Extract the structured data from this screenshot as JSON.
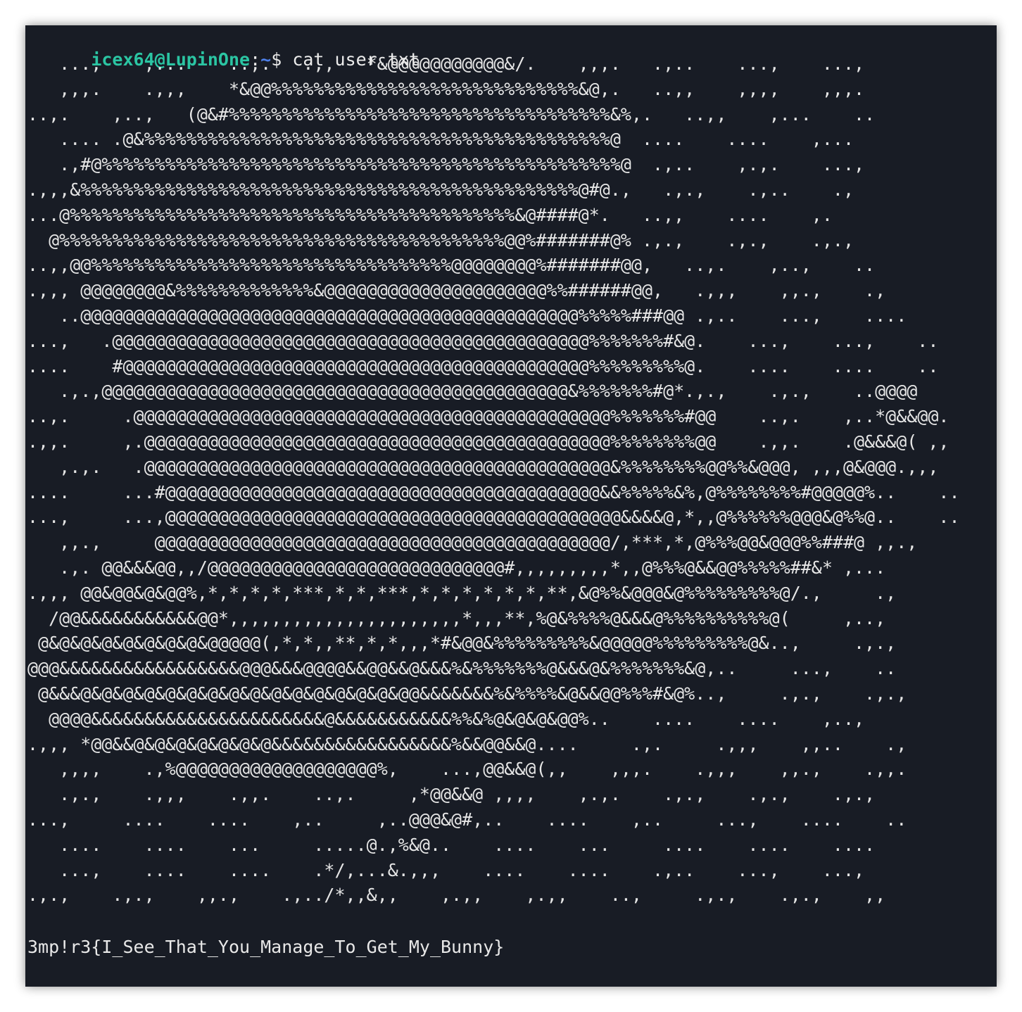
{
  "terminal": {
    "prompt_user_host": "icex64@LupinOne",
    "prompt_sep": ":",
    "prompt_path": "~",
    "prompt_symbol": "$ ",
    "command": "cat user.txt",
    "art_lines": [
      "   ...,    ,...    ..,.   .,,   *&@@@@@@@@@@@&/.    ,,,.   .,..    ...,    ...,",
      "   ,,,.    .,,,    *&@@%%%%%%%%%%%%%%%%%%%%%%%%%%%%%&@,.   ..,,    ,,,,    ,,,.",
      "..,.    ,..,   (@&#%%%%%%%%%%%%%%%%%%%%%%%%%%%%%%%%%%%%&%,.   ..,,    ,...    ..",
      "   .... .@&%%%%%%%%%%%%%%%%%%%%%%%%%%%%%%%%%%%%%%%%%%%%@  ....    ....    ,...",
      "   .,#@%%%%%%%%%%%%%%%%%%%%%%%%%%%%%%%%%%%%%%%%%%%%%%%%%@  .,..    ,.,.    ...,",
      ".,,,&%%%%%%%%%%%%%%%%%%%%%%%%%%%%%%%%%%%%%%%%%%%%%%%@#@.,   .,.,    .,..    .,",
      "...@%%%%%%%%%%%%%%%%%%%%%%%%%%%%%%%%%%%%%%%%%%&@####@*.   ..,,    ....    ,.",
      "  @%%%%%%%%%%%%%%%%%%%%%%%%%%%%%%%%%%%%%%%%%%@@%#######@% .,.,    .,.,    .,.,",
      "..,,@@%%%%%%%%%%%%%%%%%%%%%%%%%%%%%%%%%%@@@@@@@@%#######@@,   ..,.    ,..,    ..",
      ".,,, @@@@@@@@&%%%%%%%%%%%%%&@@@@@@@@@@@@@@@@@@@@@%%######@@,   .,,,    ,,.,    .,",
      "   ..@@@@@@@@@@@@@@@@@@@@@@@@@@@@@@@@@@@@@@@@@@@@@@@%%%%%###@@ .,..    ...,    ....",
      "...,   .@@@@@@@@@@@@@@@@@@@@@@@@@@@@@@@@@@@@@@@@@@@@@%%%%%%%#&@.    ...,    ...,    ..",
      "....    #@@@@@@@@@@@@@@@@@@@@@@@@@@@@@@@@@@@@@@@@@@@@%%%%%%%%%@.    ....    ....    ..",
      "   .,.,@@@@@@@@@@@@@@@@@@@@@@@@@@@@@@@@@@@@@@@@@@@@&%%%%%%%#@*.,.,    .,.,    ..@@@@",
      "..,.     .@@@@@@@@@@@@@@@@@@@@@@@@@@@@@@@@@@@@@@@@@@@@@%%%%%%%#@@    ..,.    ,..*@&&@@.",
      ".,,.     ,.@@@@@@@@@@@@@@@@@@@@@@@@@@@@@@@@@@@@@@@@@@@@%%%%%%%%@@    .,,.    .@&&&@( ,,",
      "   ,.,.   .@@@@@@@@@@@@@@@@@@@@@@@@@@@@@@@@@@@@@@@@@@@@&%%%%%%%%@@%%&@@@, ,,,@&@@@.,,,",
      "....     ...#@@@@@@@@@@@@@@@@@@@@@@@@@@@@@@@@@@@@@@@@@&&%%%%%&%,@%%%%%%%%#@@@@@%..    ..",
      "...,     ...,@@@@@@@@@@@@@@@@@@@@@@@@@@@@@@@@@@@@@@@@@@@&&&&@,*,,@%%%%%%@@@&@%%@..    ..",
      "   ,,.,     @@@@@@@@@@@@@@@@@@@@@@@@@@@@@@@@@@@@@@@@@@@/,***,*,@%%%@@&@@@%%###@ ,,.,",
      "   .,. @@&&&@@,,/@@@@@@@@@@@@@@@@@@@@@@@@@@@@#,,,,,,,,,*,,@%%%@&&@@%%%%%##&* ,...",
      ".,,, @@&@@&@&@@%,*,*,*,*,***,*,*,***,*,*,*,*,*,*,**,&@%%&@@@&@%%%%%%%%%@/.,     .,",
      "  /@@&&&&&&&&&&&@@*,,,,,,,,,,,,,,,,,,,,,,*,,,**,%@&%%%%@&&&@%%%%%%%%%%@(     ,..,",
      " @&@&@&@&@&@&@&@&@@@@@(,*,*,,**,*,*,,,*#&@@&%%%%%%%%%&@@@@@%%%%%%%%%@&..,     .,.,",
      "@@@&&&&&&&&&&&&&&&&&@@@&&&@@@@&&@@&&@&&&%&%%%%%%%@&&&@&%%%%%%%&@,..     ...,    ..",
      " @&&&@&@&@&@&@&@&@&@&@&@&@&@&@&@&@&@@&&&&&&&%&%%%%&@&&@@%%%#&@%..,     .,.,    .,.,",
      "  @@@@&&&&&&&&&&&&&&&&&&&&&&@&&&&&&&&&&&%%&%@&@&@&@@%..    ....    ....    ,..,",
      ".,,, *@@&&@&@&@&@&@&@&@&&&&&&&&&&&&&&&&&%&&@@&&@....     .,.     .,,,    ,,..    .,",
      "   ,,,,    .,%@@@@@@@@@@@@@@@@@@@%,    ...,@@&&@(,,    ,,,.    .,,,    ,,.,    .,,.",
      "   .,.,    .,,,    .,,.    ..,.     ,*@@&&@ ,,,,    ,.,.    .,.,    .,.,    .,.,",
      "...,     ....    ....    ,..     ,..@@@&@#,..    ....    ,..     ...,    ....    ..",
      "   ....    ....    ...     .....@.,%&@..    ....    ...     ....    ....    ....",
      "   ...,    ....    ....    .*/,...&.,,,    ....    ....    .,..    ...,    ...,",
      ".,.,    .,.,    ,,.,    .,../*,,&,,    ,.,,    ,.,,    ..,     .,.,    .,.,    ,,"
    ],
    "blank_line": "",
    "flag": "3mp!r3{I_See_That_You_Manage_To_Get_My_Bunny}"
  },
  "colors": {
    "background": "#181c25",
    "user_host": "#2bc5a3",
    "path": "#4d7fe8",
    "text": "#e6e6e6"
  }
}
